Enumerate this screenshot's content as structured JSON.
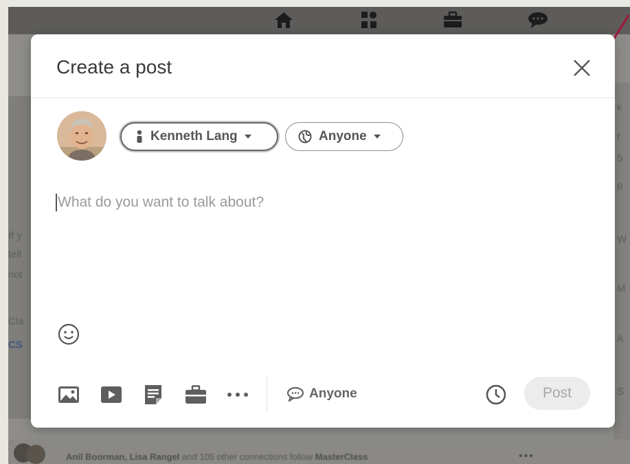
{
  "modal": {
    "title": "Create a post",
    "author_name": "Kenneth Lang",
    "audience": "Anyone",
    "composer_placeholder": "What do you want to talk about?",
    "comment_scope": "Anyone",
    "post_label": "Post"
  },
  "background": {
    "footer_text_names": "Anil Boorman, Lisa Rangel",
    "footer_text_rest": "and 105 other connections follow",
    "footer_text_brand": "MasterClass",
    "more_label": "•••",
    "left_fragments": [
      "If y",
      "tell",
      "not",
      "Cla",
      "CS"
    ],
    "right_fragments": [
      "k",
      "r",
      "5",
      "p",
      "W",
      "M",
      "A",
      "S"
    ]
  },
  "colors": {
    "accent_disabled": "#ececec",
    "annotation_arrow": "#a3163c",
    "nav_icons": "#1c1c1c"
  },
  "icons": [
    "home-icon",
    "network-icon",
    "jobs-icon",
    "messaging-icon",
    "close-icon",
    "globe-icon",
    "person-icon",
    "emoji-icon",
    "photo-icon",
    "video-icon",
    "document-icon",
    "briefcase-icon",
    "more-icon",
    "comment-icon",
    "clock-icon"
  ]
}
